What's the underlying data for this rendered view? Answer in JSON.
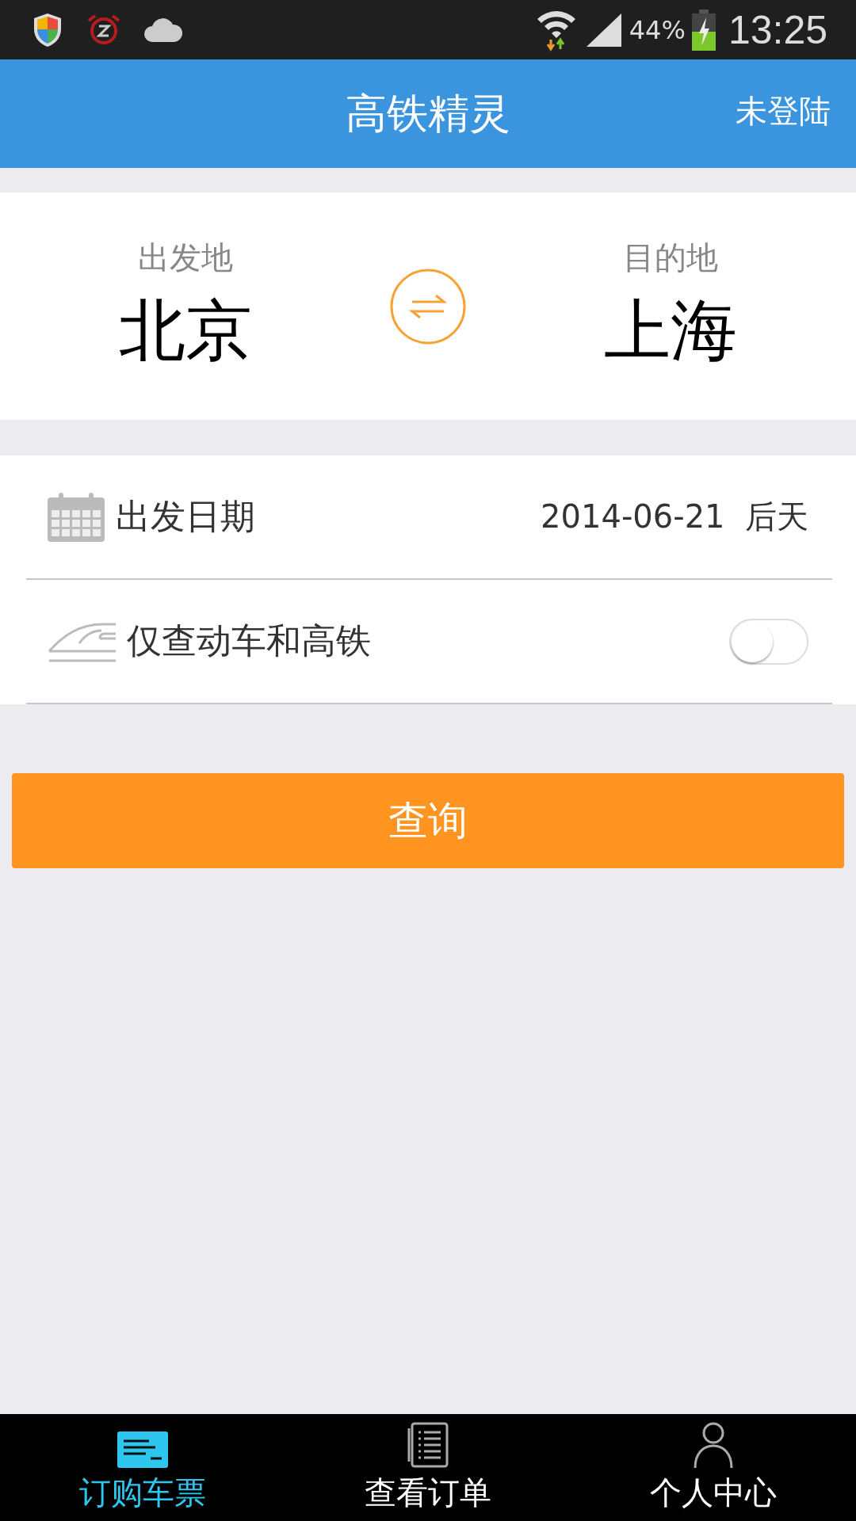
{
  "status_bar": {
    "battery_percent": "44%",
    "time": "13:25"
  },
  "header": {
    "title": "高铁精灵",
    "login": "未登陆"
  },
  "route": {
    "from_label": "出发地",
    "from": "北京",
    "to_label": "目的地",
    "to": "上海"
  },
  "date_row": {
    "label": "出发日期",
    "date": "2014-06-21",
    "relative": "后天"
  },
  "filter_row": {
    "label": "仅查动车和高铁",
    "on": false
  },
  "search_button": "查询",
  "nav": [
    {
      "label": "订购车票",
      "selected": true,
      "kind": "ticket"
    },
    {
      "label": "查看订单",
      "selected": false,
      "kind": "orders"
    },
    {
      "label": "个人中心",
      "selected": false,
      "kind": "profile"
    }
  ]
}
